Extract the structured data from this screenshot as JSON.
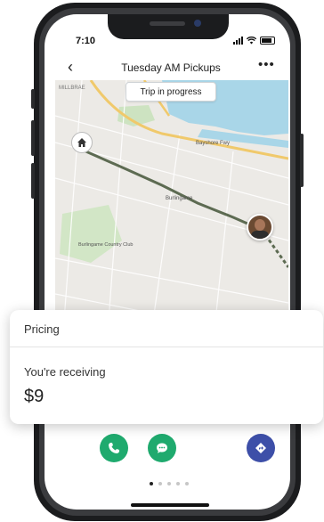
{
  "status_bar": {
    "time": "7:10"
  },
  "nav": {
    "back_icon": "chevron-left-icon",
    "title": "Tuesday AM Pickups",
    "more_icon": "more-dots-icon"
  },
  "map": {
    "status_pill": "Trip in progress",
    "labels": {
      "top_left": "MILLBRAE",
      "road": "Bayshore Fwy",
      "city": "Burlingame",
      "club": "Burlingame Country Club"
    },
    "route_color": "#5d6b52"
  },
  "pricing": {
    "title": "Pricing",
    "receiving_label": "You're receiving",
    "amount": "$9"
  },
  "actions": {
    "call_icon": "phone-icon",
    "message_icon": "chat-icon",
    "navigate_icon": "navigation-icon"
  },
  "colors": {
    "green": "#1faa6e",
    "blue": "#3d4fa8"
  }
}
